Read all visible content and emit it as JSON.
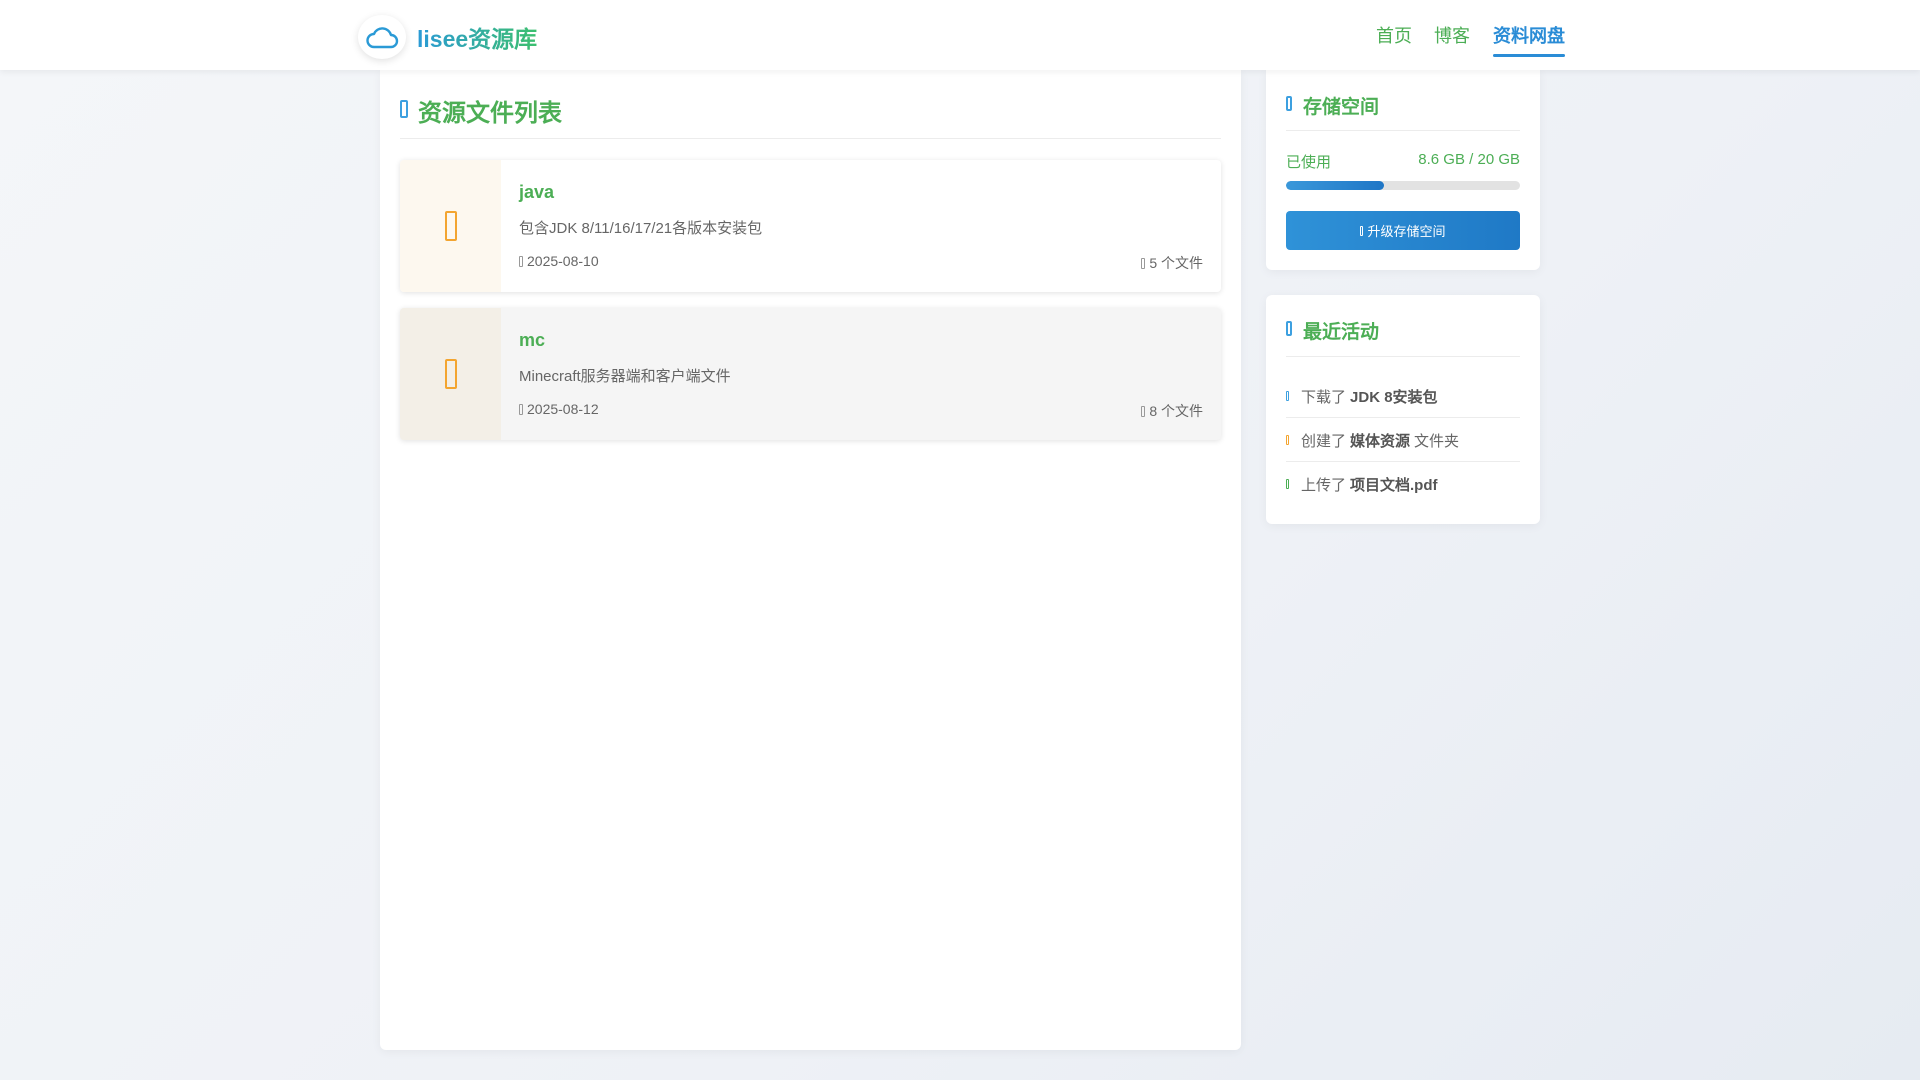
{
  "header": {
    "brand": "lisee资源库",
    "nav": [
      {
        "label": "首页"
      },
      {
        "label": "博客"
      },
      {
        "label": "资料网盘",
        "active": true
      }
    ]
  },
  "main": {
    "title": "资源文件列表",
    "files": [
      {
        "name": "java",
        "description": "包含JDK 8/11/16/17/21各版本安装包",
        "date": "2025-08-10",
        "count": "5 个文件"
      },
      {
        "name": "mc",
        "description": "Minecraft服务器端和客户端文件",
        "date": "2025-08-12",
        "count": "8 个文件"
      }
    ]
  },
  "storage": {
    "title": "存储空间",
    "used_label": "已使用",
    "used_value": "8.6 GB / 20 GB",
    "used_fraction": 0.42,
    "upgrade_label": "升级存储空间"
  },
  "activity": {
    "title": "最近活动",
    "items": [
      {
        "prefix": "下载了",
        "target": "JDK 8安装包",
        "suffix": "",
        "dot_color": "#3da0e0"
      },
      {
        "prefix": "创建了",
        "target": "媒体资源",
        "suffix": "文件夹",
        "dot_color": "#f3a530"
      },
      {
        "prefix": "上传了",
        "target": "项目文档.pdf",
        "suffix": "",
        "dot_color": "#4cae55"
      }
    ]
  },
  "colors": {
    "accent_blue": "#2a8cd6",
    "accent_green": "#4cae55",
    "folder_orange": "#f3a530"
  },
  "icons": {
    "logo": "cloud-icon",
    "folder": "folder-icon",
    "calendar": "calendar-icon",
    "file": "file-icon"
  }
}
